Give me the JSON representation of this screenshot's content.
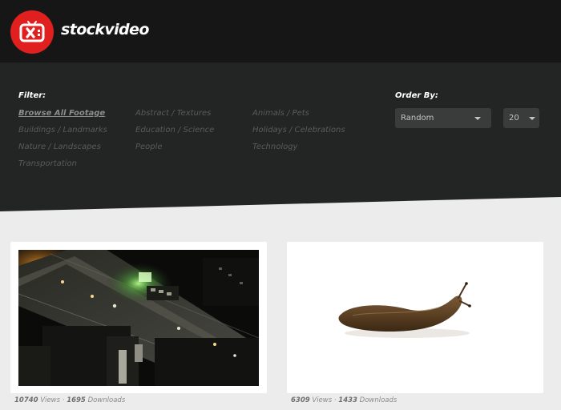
{
  "header": {
    "brand": "stockvideo",
    "logo_color": "#e0201f"
  },
  "filter": {
    "label": "Filter:",
    "categories": [
      {
        "label": "Browse All Footage",
        "active": true
      },
      {
        "label": "Buildings / Landmarks",
        "active": false
      },
      {
        "label": "Nature / Landscapes",
        "active": false
      },
      {
        "label": "Transportation",
        "active": false
      },
      {
        "label": "Abstract / Textures",
        "active": false
      },
      {
        "label": "Education / Science",
        "active": false
      },
      {
        "label": "People",
        "active": false
      },
      {
        "label": "Animals / Pets",
        "active": false
      },
      {
        "label": "Holidays / Celebrations",
        "active": false
      },
      {
        "label": "Technology",
        "active": false
      }
    ]
  },
  "order": {
    "label": "Order By:",
    "sort_value": "Random",
    "count_value": "20"
  },
  "videos": [
    {
      "views": "10740",
      "views_label": "Views",
      "separator": "·",
      "downloads": "1695",
      "downloads_label": "Downloads",
      "subject": "city-street-at-night"
    },
    {
      "views": "6309",
      "views_label": "Views",
      "separator": "·",
      "downloads": "1433",
      "downloads_label": "Downloads",
      "subject": "slug-on-white"
    }
  ],
  "colors": {
    "header_bg": "#161616",
    "filter_bg": "#232525",
    "page_bg": "#ececec",
    "active_filter": "#8a8d8d",
    "inactive_filter": "#585b5b"
  }
}
